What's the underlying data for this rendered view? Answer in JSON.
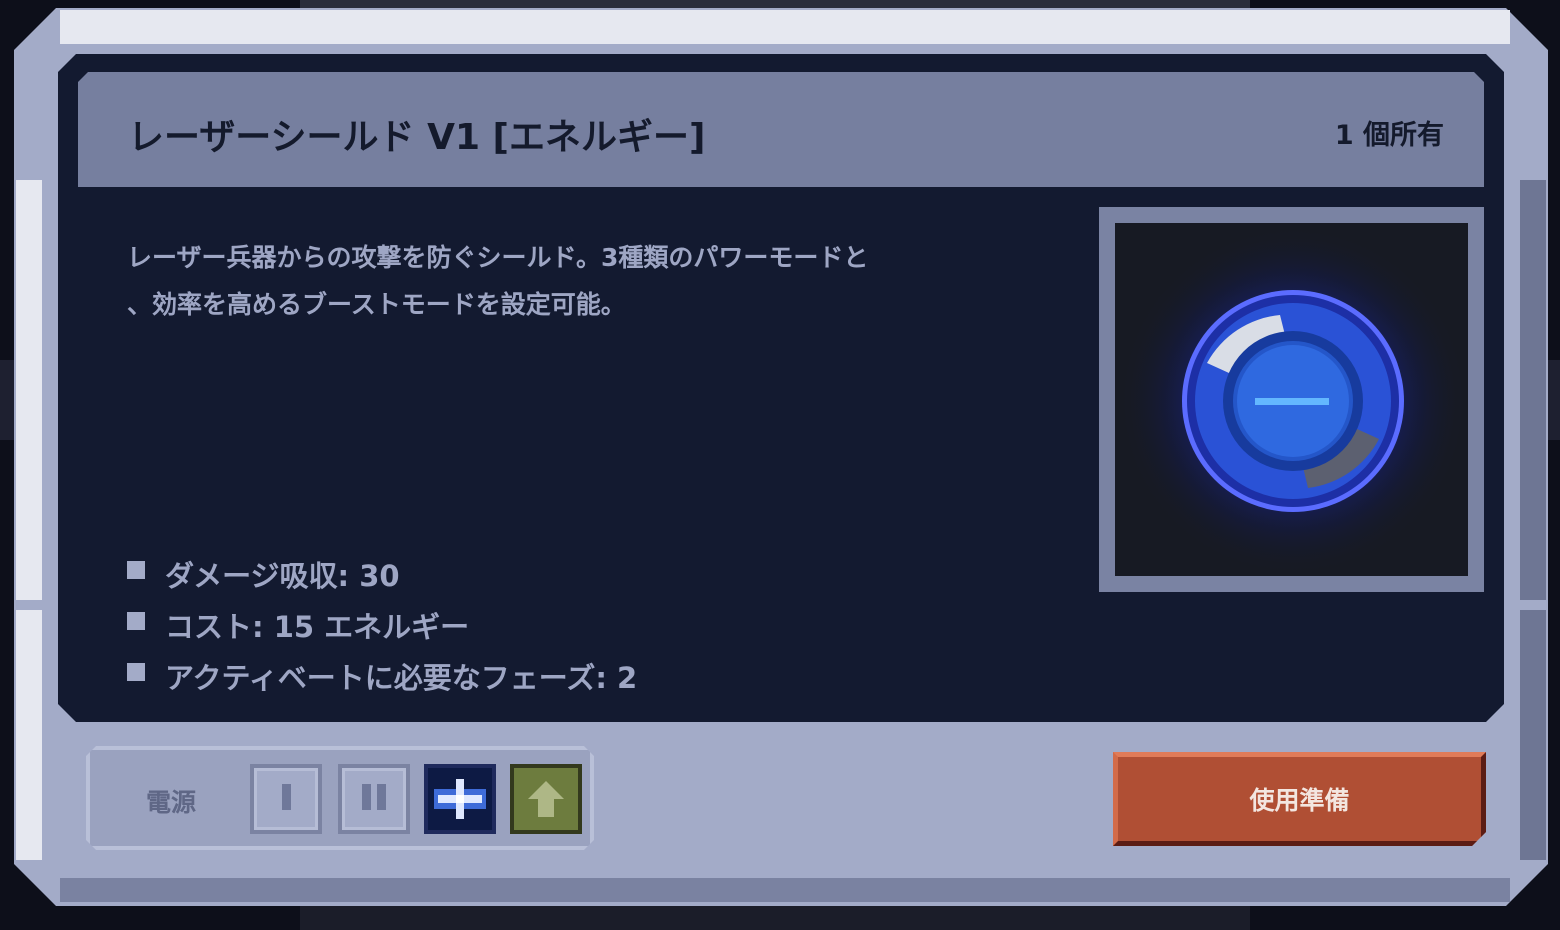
{
  "item": {
    "title": "レーザーシールド V1 [エネルギー]",
    "owned": "1 個所有",
    "description_lines": [
      "レーザー兵器からの攻撃を防ぐシールド。3種類のパワーモードと",
      "、効率を高めるブーストモードを設定可能。"
    ],
    "stats": [
      "ダメージ吸収: 30",
      "コスト: 15 エネルギー",
      "アクティベートに必要なフェーズ: 2"
    ],
    "image_icon": "blue-shield-orb-icon"
  },
  "controls": {
    "power_label": "電源",
    "modes": [
      {
        "name": "power-mode-1",
        "icon": "single-bar-icon",
        "active": false
      },
      {
        "name": "power-mode-2",
        "icon": "double-bar-icon",
        "active": false
      },
      {
        "name": "power-mode-3",
        "icon": "plus-cross-icon",
        "active": true
      },
      {
        "name": "boost-mode",
        "icon": "up-arrow-icon",
        "active": true
      }
    ],
    "ready_button": "使用準備"
  },
  "colors": {
    "frame": "#a3abc8",
    "panel": "#131a30",
    "title_bar": "#767f9f",
    "text_light": "#9ea6c4",
    "button_red": "#b04f34",
    "boost_green": "#6d7c3e",
    "mode_blue": "#0d1a44"
  }
}
